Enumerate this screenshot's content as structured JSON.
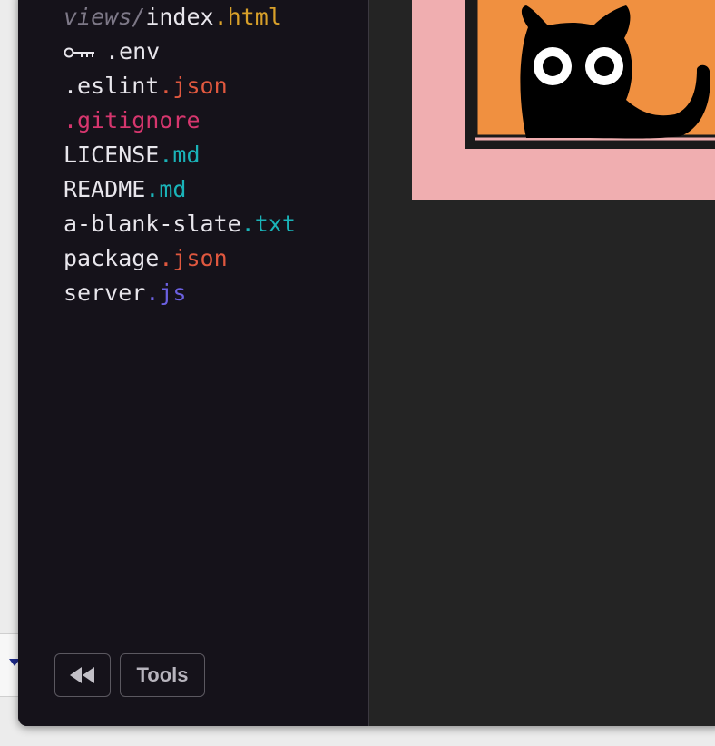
{
  "files": [
    {
      "prefix": "views/",
      "name": "index",
      "ext": ".html",
      "prefix_color": "#7d7887",
      "name_color": "#e8e6ec",
      "ext_color": "#d8a02a"
    },
    {
      "icon": "key-icon",
      "name": ".env",
      "ext": "",
      "name_color": "#e8e6ec",
      "ext_color": "#e8e6ec"
    },
    {
      "name": ".eslint",
      "ext": ".json",
      "name_color": "#e8e6ec",
      "ext_color": "#e0583f"
    },
    {
      "name": ".gitignore",
      "ext": "",
      "name_color": "#d6366e",
      "ext_color": "#d6366e"
    },
    {
      "name": "LICENSE",
      "ext": ".md",
      "name_color": "#e8e6ec",
      "ext_color": "#1ab3b8"
    },
    {
      "name": "README",
      "ext": ".md",
      "name_color": "#e8e6ec",
      "ext_color": "#1ab3b8"
    },
    {
      "name": "a-blank-slate",
      "ext": ".txt",
      "name_color": "#e8e6ec",
      "ext_color": "#1ab3b8"
    },
    {
      "name": "package",
      "ext": ".json",
      "name_color": "#e8e6ec",
      "ext_color": "#e0583f"
    },
    {
      "name": "server",
      "ext": ".js",
      "name_color": "#e8e6ec",
      "ext_color": "#6b60e0"
    }
  ],
  "toolbar": {
    "rewind_icon": "rewind-icon",
    "tools_label": "Tools"
  },
  "preview": {
    "illustration": "black-cat-in-window",
    "colors": {
      "frame_bg": "#f0aeb0",
      "window_fill": "#f09040",
      "cat": "#000000"
    }
  },
  "background_text": "... ... ... ... ... ..."
}
